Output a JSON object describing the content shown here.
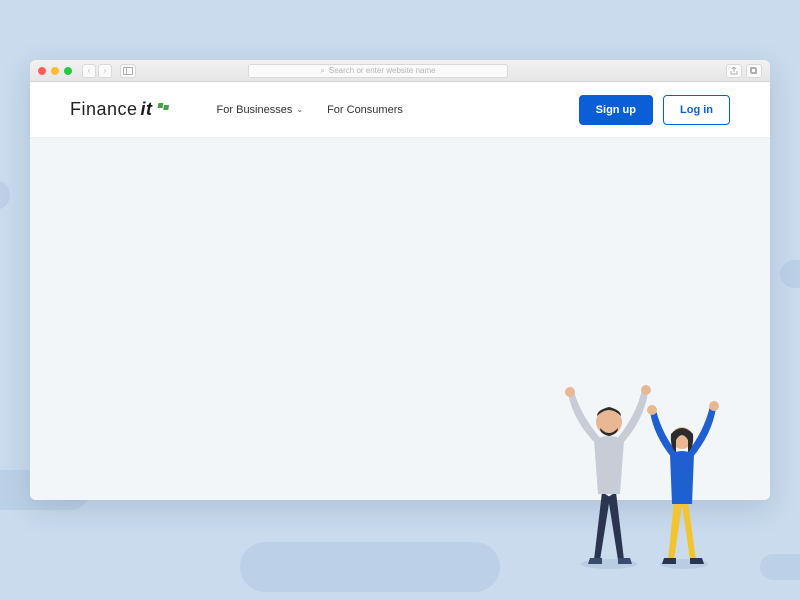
{
  "browser": {
    "url_placeholder": "Search or enter website name"
  },
  "header": {
    "logo_part1": "Finance",
    "logo_part2": "it",
    "nav": {
      "businesses": "For Businesses",
      "consumers": "For Consumers"
    },
    "actions": {
      "signup": "Sign up",
      "login": "Log in"
    }
  },
  "colors": {
    "primary": "#0a5fd6",
    "logo_accent": "#4aa04a",
    "bg": "#c9dbed"
  }
}
